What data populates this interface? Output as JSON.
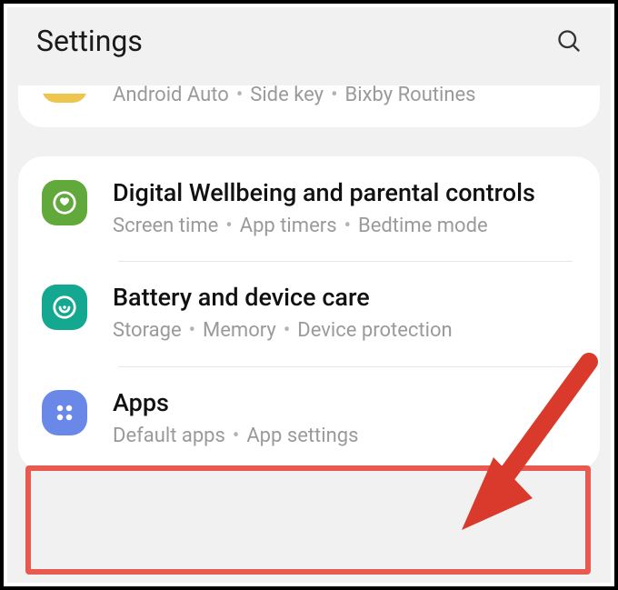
{
  "header": {
    "title": "Settings"
  },
  "partial_row": {
    "sub_items": [
      "Android Auto",
      "Side key",
      "Bixby Routines"
    ]
  },
  "rows": [
    {
      "id": "digital-wellbeing",
      "title": "Digital Wellbeing and parental controls",
      "sub_items": [
        "Screen time",
        "App timers",
        "Bedtime mode"
      ],
      "icon_color": "green"
    },
    {
      "id": "battery-device-care",
      "title": "Battery and device care",
      "sub_items": [
        "Storage",
        "Memory",
        "Device protection"
      ],
      "icon_color": "teal"
    },
    {
      "id": "apps",
      "title": "Apps",
      "sub_items": [
        "Default apps",
        "App settings"
      ],
      "icon_color": "blue"
    }
  ],
  "annotation": {
    "highlight_row": "apps"
  },
  "colors": {
    "highlight": "#e85a4f",
    "green": "#62a93c",
    "teal": "#15a890",
    "blue": "#6988e7"
  }
}
